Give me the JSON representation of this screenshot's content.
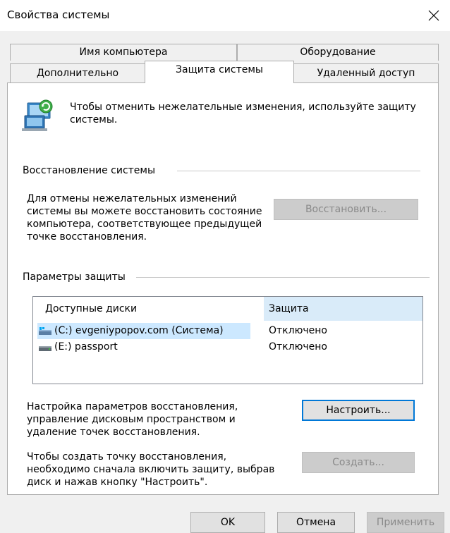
{
  "window": {
    "title": "Свойства системы",
    "close_glyph": "✕"
  },
  "tabs": {
    "computer_name": "Имя компьютера",
    "hardware": "Оборудование",
    "advanced": "Дополнительно",
    "system_protection": "Защита системы",
    "remote": "Удаленный доступ"
  },
  "intro": {
    "text": "Чтобы отменить нежелательные изменения, используйте защиту системы.",
    "icon": "system-protection-icon"
  },
  "restore_group": {
    "title": "Восстановление системы",
    "description": "Для отмены нежелательных изменений системы вы можете восстановить состояние компьютера, соответствующее предыдущей точке восстановления.",
    "button": "Восстановить..."
  },
  "protection_group": {
    "title": "Параметры защиты",
    "columns": [
      "Доступные диски",
      "Защита"
    ],
    "rows": [
      {
        "drive": "(C:) evgeniypopov.com (Система)",
        "protection": "Отключено",
        "icon": "system-drive-icon",
        "selected": true
      },
      {
        "drive": "(E:) passport",
        "protection": "Отключено",
        "icon": "drive-icon",
        "selected": false
      }
    ],
    "configure_text": "Настройка параметров восстановления, управление дисковым пространством и удаление точек восстановления.",
    "configure_button": "Настроить...",
    "create_text": "Чтобы создать точку восстановления, необходимо сначала включить защиту, выбрав диск и нажав кнопку \"Настроить\".",
    "create_button": "Создать..."
  },
  "footer": {
    "ok": "OK",
    "cancel": "Отмена",
    "apply": "Применить"
  },
  "colors": {
    "accent": "#0078d7",
    "selection": "#cce8ff",
    "header": "#d9ebf9",
    "annotation_arrow": "#c00000"
  }
}
